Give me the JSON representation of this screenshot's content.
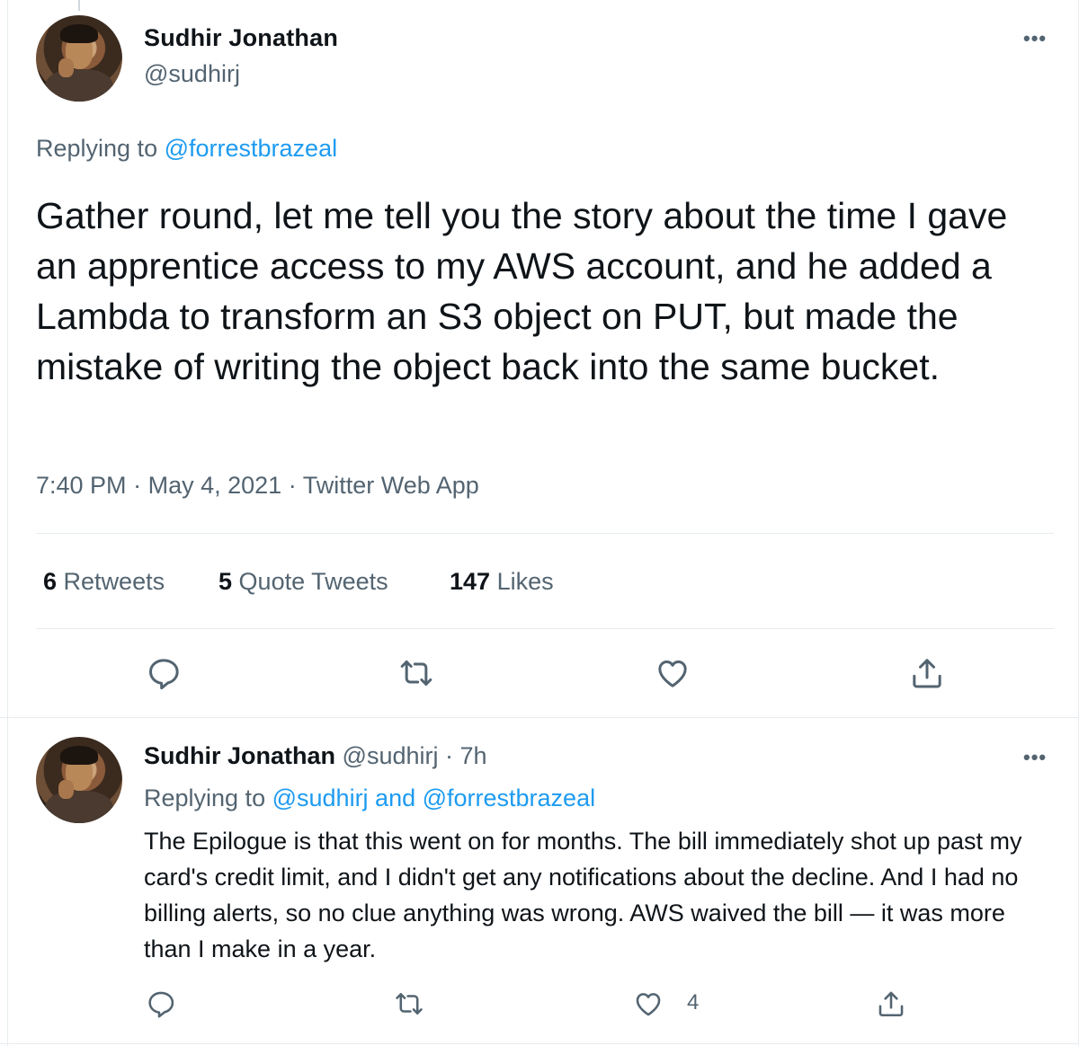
{
  "main_tweet": {
    "author_name": "Sudhir Jonathan",
    "author_handle": "@sudhirj",
    "more_label": "•••",
    "replying_prefix": "Replying to",
    "replying_handle": "@forrestbrazeal",
    "text": "Gather round, let me tell you the story about the time I gave an apprentice access to my AWS account, and he added a Lambda to transform an S3 object on PUT, but made the mistake of writing the object back into the same bucket.",
    "time": "7:40 PM",
    "date": "May 4, 2021",
    "source": "Twitter Web App",
    "dot": "·",
    "stats": {
      "retweets_count": "6",
      "retweets_label": "Retweets",
      "quotes_count": "5",
      "quotes_label": "Quote Tweets",
      "likes_count": "147",
      "likes_label": "Likes"
    },
    "actions": [
      "reply-icon",
      "retweet-icon",
      "like-icon",
      "share-icon"
    ]
  },
  "reply_tweet": {
    "author_name": "Sudhir Jonathan",
    "author_handle": "@sudhirj",
    "dot": "·",
    "time_ago": "7h",
    "more_label": "•••",
    "replying_prefix": "Replying to",
    "replying_handles": "@sudhirj and @forrestbrazeal",
    "text": "The Epilogue is that this went on for months. The bill immediately shot up past my card's credit limit, and I didn't get any notifications about the decline. And I had no billing alerts, so no clue anything was wrong. AWS waived the bill — it was more than I make in a year.",
    "like_count": "4",
    "actions": [
      "reply-icon",
      "retweet-icon",
      "like-icon",
      "share-icon"
    ]
  },
  "colors": {
    "link": "#1d9bf0",
    "secondary_text": "#536471",
    "primary_text": "#0f1419",
    "border": "#e6ecf0"
  }
}
